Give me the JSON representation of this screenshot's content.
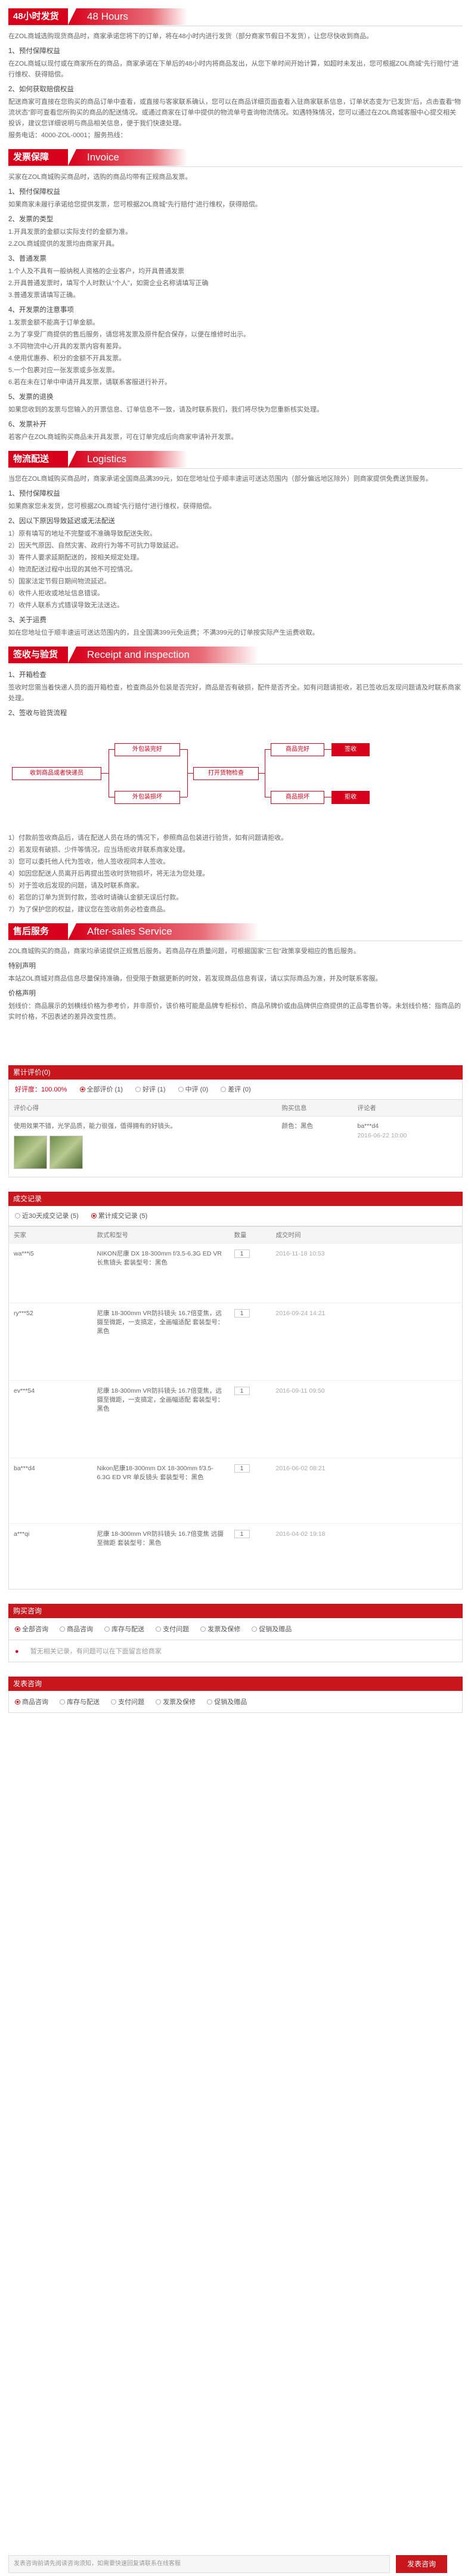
{
  "h48": {
    "cn": "48小时发货",
    "en": "48 Hours"
  },
  "p48": [
    "在ZOL商城选购现货商品时，商家承诺您将下的订单，将在48小时内进行发货（部分商家节假日不发货），让您尽快收到商品。",
    "1、预付保障权益",
    "在ZOL商城以现付或在商家所在的商品，商家承诺在下单后的48小时内将商品发出，从您下单时间开始计算，如超时未发出，您可根据ZOL商城“先行赔付”进行维权、获得赔偿。",
    "2、如何获取赔偿权益",
    "配送商家可直接在您购买的商品订单中查看，或直接与客家联系确认，您可以在商品详细页面查看入驻商家联系信息，订单状态变为“已发货”后，点击查看“物流状态”即可查看您所购买的商品的配送情况。或通过商家在订单中提供的物流单号查询物流情况。如遇特殊情况，您可以通过在ZOL商城客服中心提交相关投诉，建议您详细说明与商品相关信息，便于我们快速处理。",
    "服务电话：4000-ZOL-0001；服务热线："
  ],
  "invoice": {
    "cn": "发票保障",
    "en": "Invoice"
  },
  "pinv": [
    "买家在ZOL商城购买商品时，选购的商品均带有正规商品发票。",
    "1、预付保障权益",
    "如果商家未履行承诺给您提供发票，您可根据ZOL商城“先行赔付”进行维权，获得赔偿。",
    "2、发票的类型",
    "1.开具发票的金额以实际支付的金额为准。",
    "2.ZOL商城提供的发票均由商家开具。",
    "3、普通发票",
    "1.个人及不具有一般纳税人资格的企业客户，均开具普通发票",
    "2.开具普通发票时，填写个人时默认“个人”，如需企业名称请填写正确",
    "3.普通发票请填写正确。",
    "4、开发票的注意事项",
    "1.发票金额不能高于订单金额。",
    "2.为了享受厂商提供的售后服务，请您将发票及原件配合保存，以便在维修时出示。",
    "3.不同物流中心开具的发票内容有差异。",
    "4.使用优惠券、积分的金额不开具发票。",
    "5.一个包裹对应一张发票或多张发票。",
    "6.若在未在订单中申请开具发票，请联系客服进行补开。",
    "5、发票的退换",
    "如果您收到的发票与您输入的开票信息、订单信息不一致，请及时联系我们，我们将尽快为您重新核实处理。",
    "6、发票补开",
    "若客户在ZOL商城购买商品未开具发票，可在订单完成后向商家申请补开发票。"
  ],
  "logistics": {
    "cn": "物流配送",
    "en": "Logistics"
  },
  "plog": [
    "当您在ZOL商城购买商品时，商家承诺全国商品满399元，如在您地址位于顺丰速运可送达范围内（部分偏远地区除外）则商家提供免费送货服务。",
    "1、预付保障权益",
    "如果商家您未发货，您可根据ZOL商城“先行赔付”进行维权，获得赔偿。",
    "2、因以下原因导致延迟或无法配送",
    "1）原有填写的地址不完整或不准确导致配送失败。",
    "2）因天气原因、自然灾害、政府行为等不可抗力导致延迟。",
    "3）寄件人要求延期配送的，按相关规定处理。",
    "4）物流配送过程中出现的其他不可控情况。",
    "5）国家法定节假日期间物流延迟。",
    "6）收件人拒收或地址信息错误。",
    "7）收件人联系方式错误导致无法送达。",
    "3、关于运费",
    "如在您地址位于顺丰速运可送达范围内的，且全国满399元免运费；不满399元的订单按实际产生运费收取。"
  ],
  "receipt": {
    "cn": "签收与验货",
    "en": "Receipt and inspection"
  },
  "prec": [
    "1、开箱检查",
    "签收时您需当着快递人员的面开箱检查，检查商品外包装是否完好，商品是否有破损，配件是否齐全。如有问题请拒收，若已签收后发现问题请及时联系商家处理。",
    "2、签收与验货流程"
  ],
  "flow": {
    "a": "收到商品或者快递员",
    "b": "外包装完好",
    "c": "外包装损坏",
    "d": "打开货物检查",
    "e": "商品完好",
    "f": "商品损坏",
    "g": "签收",
    "h": "拒收"
  },
  "prec2": [
    "1）付款前签收商品后，请在配送人员在场的情况下，参照商品包装进行验货，如有问题请拒收。",
    "2）若发现有破损、少件等情况，应当场拒收并联系商家处理。",
    "3）您可以委托他人代为签收，他人签收视同本人签收。",
    "4）如因您配送人员离开后再提出签收时货物损坏，将无法为您处理。",
    "5）对于签收后发现的问题，请及时联系商家。",
    "6）若您的订单为货到付款，签收时请确认金额无误后付款。",
    "7）为了保护您的权益，建议您在签收前务必检查商品。"
  ],
  "after": {
    "cn": "售后服务",
    "en": "After-sales Service"
  },
  "paft": [
    "ZOL商城购买的商品，商家均承诺提供正规售后服务。若商品存在质量问题，可根据国家“三包”政策享受相应的售后服务。",
    "特别声明",
    "本站ZOL商城对商品信息尽量保持准确，但受限于数据更新的时效，若发现商品信息有误，请以实际商品为准，并及时联系客服。",
    "价格声明",
    "划线价：商品展示的划横线价格为参考价，并非原价，该价格可能是品牌专柜标价、商品吊牌价或由品牌供应商提供的正品零售价等。未划线价格：指商品的实时价格，不因表述的差异改变性质。"
  ],
  "reviews": {
    "bar": "累计评价(0)",
    "all": "好评度：100.00%",
    "tabs": [
      "全部评价 (1)",
      "好评 (1)",
      "中评 (0)",
      "差评 (0)"
    ],
    "h1": "评价心得",
    "h2": "购买信息",
    "h3": "评论者",
    "text": "使用效果不错，光学品质，能力很强，值得拥有的好镜头。",
    "buy": "颜色：黑色",
    "user": "ba***d4",
    "date": "2016-06-22 10:00"
  },
  "trade": {
    "bar": "成交记录",
    "tabs": [
      "近30天成交记录 (5)",
      "累计成交记录 (5)"
    ],
    "cols": [
      "买家",
      "款式和型号",
      "数量",
      "成交时间"
    ],
    "rows": [
      {
        "u": "wa***i5",
        "m": "NIKON尼康 DX 18-300mm f/3.5-6.3G ED VR 长焦镜头 套装型号：黑色",
        "q": "1",
        "t": "2016-11-18 10:53"
      },
      {
        "u": "ry***52",
        "m": "尼康 18-300mm VR防抖镜头 16.7倍变焦，远摄至微距，一支搞定，全画幅适配 套装型号：黑色",
        "q": "1",
        "t": "2016-09-24 14:21"
      },
      {
        "u": "ev***54",
        "m": "尼康 18-300mm VR防抖镜头 16.7倍变焦，远摄至微距，一支搞定，全画幅适配 套装型号：黑色",
        "q": "1",
        "t": "2016-09-11 09:50"
      },
      {
        "u": "ba***d4",
        "m": "Nikon尼康18-300mm DX 18-300mm f/3.5-6.3G ED VR 单反镜头 套装型号：黑色",
        "q": "1",
        "t": "2016-06-02 08:21"
      },
      {
        "u": "a***qi",
        "m": "尼康 18-300mm VR防抖镜头 16.7倍变焦 远摄至微距 套装型号：黑色",
        "q": "1",
        "t": "2016-04-02 19:18"
      }
    ]
  },
  "consult": {
    "bar": "购买咨询",
    "tabs": [
      "全部咨询",
      "商品咨询",
      "库存与配送",
      "支付问题",
      "发票及保修",
      "促销及赠品"
    ],
    "empty": "暂无相关记录，有问题可以在下面留言给商家"
  },
  "ask": {
    "bar": "发表咨询",
    "tabs": [
      "商品咨询",
      "库存与配送",
      "支付问题",
      "发票及保修",
      "促销及赠品"
    ],
    "ph": "发表咨询前请先阅读咨询须知，如需要快速回复请联系在线客服",
    "btn": "发表咨询"
  }
}
